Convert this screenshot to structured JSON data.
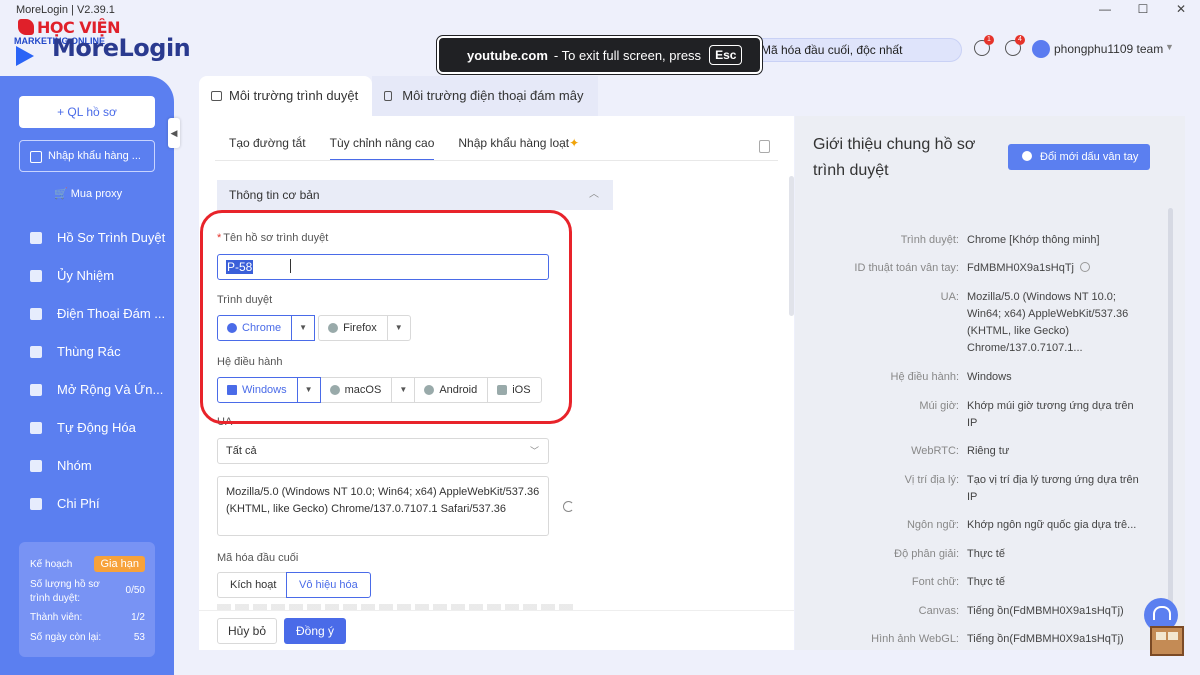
{
  "window": {
    "title": "MoreLogin | V2.39.1",
    "controls": [
      "—",
      "☐",
      "✕"
    ]
  },
  "logo": {
    "top": "HỌC VIỆN",
    "sub": "MARKETING ONLINE",
    "brand": "MoreLogin"
  },
  "fullscreen_notice": {
    "site": "youtube.com",
    "text": "-  To exit full screen, press",
    "key": "Esc"
  },
  "promo": {
    "text": "Mã hóa đầu cuối, độc nhất"
  },
  "header": {
    "badge_1": "1",
    "badge_2": "4",
    "user": "phongphu1109 team"
  },
  "sidebar": {
    "new_profile": "+ QL hồ sơ",
    "import": "Nhập khẩu hàng ...",
    "buy_proxy": "Mua proxy",
    "items": [
      {
        "label": "Hồ Sơ Trình Duyệt",
        "icon": "browser-icon"
      },
      {
        "label": "Ủy Nhiệm",
        "icon": "proxy-icon"
      },
      {
        "label": "Điện Thoại Đám ...",
        "icon": "phone-icon"
      },
      {
        "label": "Thùng Rác",
        "icon": "trash-icon"
      },
      {
        "label": "Mở Rộng Và Ứn...",
        "icon": "puzzle-icon"
      },
      {
        "label": "Tự Động Hóa",
        "icon": "automation-icon"
      },
      {
        "label": "Nhóm",
        "icon": "group-icon"
      },
      {
        "label": "Chi Phí",
        "icon": "cost-icon"
      }
    ],
    "plan": {
      "label": "Kế hoạch",
      "renew": "Gia hạn",
      "profiles_label": "Số lượng hồ sơ trình duyệt:",
      "profiles_value": "0/50",
      "members_label": "Thành viên:",
      "members_value": "1/2",
      "days_label": "Số ngày còn lại:",
      "days_value": "53"
    }
  },
  "top_tabs": [
    "Môi trường trình duyệt",
    "Môi trường điện thoại đám mây"
  ],
  "form": {
    "sub_tabs": [
      "Tạo đường tắt",
      "Tùy chỉnh nâng cao",
      "Nhập khẩu hàng loạt"
    ],
    "section": "Thông tin cơ bản",
    "name_label": "Tên hồ sơ trình duyệt",
    "name_value": "P-58",
    "browser_label": "Trình duyệt",
    "browsers": [
      "Chrome",
      "Firefox"
    ],
    "os_label": "Hệ điều hành",
    "os": [
      "Windows",
      "macOS",
      "Android",
      "iOS"
    ],
    "ua_label": "UA",
    "ua_select": "Tất cả",
    "ua_value": "Mozilla/5.0 (Windows NT 10.0; Win64; x64) AppleWebKit/537.36 (KHTML, like Gecko) Chrome/137.0.7107.1 Safari/537.36",
    "e2e_label": "Mã hóa đầu cuối",
    "e2e_options": [
      "Kích hoạt",
      "Vô hiệu hóa"
    ],
    "cancel": "Hủy bỏ",
    "ok": "Đồng ý"
  },
  "overview": {
    "title": "Giới thiệu chung hồ sơ trình duyệt",
    "refresh_button": "Đổi mới dấu vân tay",
    "rows": [
      {
        "k": "Trình duyệt:",
        "v": "Chrome [Khớp thông minh]"
      },
      {
        "k": "ID thuật toán vân tay:",
        "v": "FdMBMH0X9a1sHqTj"
      },
      {
        "k": "UA:",
        "v": "Mozilla/5.0 (Windows NT 10.0; Win64; x64) AppleWebKit/537.36 (KHTML, like Gecko) Chrome/137.0.7107.1..."
      },
      {
        "k": "Hệ điều hành:",
        "v": "Windows"
      },
      {
        "k": "Múi giờ:",
        "v": "Khớp múi giờ tương ứng dựa trên IP"
      },
      {
        "k": "WebRTC:",
        "v": "Riêng tư"
      },
      {
        "k": "Vị trí địa lý:",
        "v": "Tạo vị trí địa lý tương ứng dựa trên IP"
      },
      {
        "k": "Ngôn ngữ:",
        "v": "Khớp ngôn ngữ quốc gia dựa trê..."
      },
      {
        "k": "Độ phân giải:",
        "v": "Thực tế"
      },
      {
        "k": "Font chữ:",
        "v": "Thực tế"
      },
      {
        "k": "Canvas:",
        "v": "Tiếng ồn(FdMBMH0X9a1sHqTj)"
      },
      {
        "k": "Hình ảnh WebGL:",
        "v": "Tiếng ồn(FdMBMH0X9a1sHqTj)"
      }
    ]
  }
}
